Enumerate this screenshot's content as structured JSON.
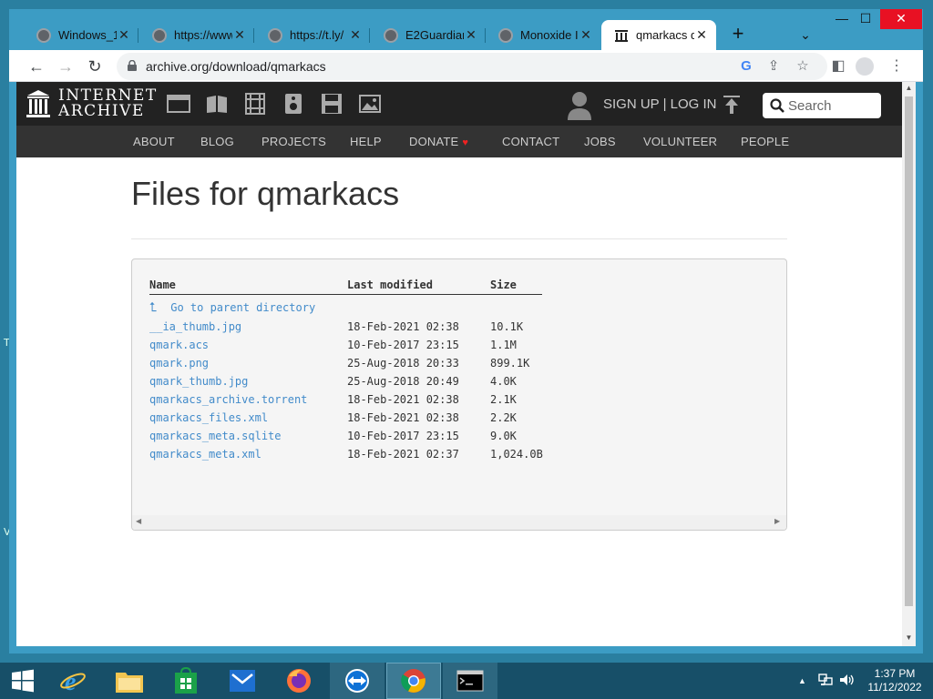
{
  "browser": {
    "tabs": [
      {
        "title": "Windows_1"
      },
      {
        "title": "https://www."
      },
      {
        "title": "https://t.ly/"
      },
      {
        "title": "E2Guardian"
      },
      {
        "title": "Monoxide I"
      },
      {
        "title": "qmarkacs d",
        "active": true
      }
    ],
    "new_tab": "+",
    "tab_menu": "⌄",
    "url": "archive.org/download/qmarkacs"
  },
  "site": {
    "logo_line1": "INTERNET",
    "logo_line2": "ARCHIVE",
    "signup": "SIGN UP | LOG IN",
    "search_placeholder": "Search",
    "nav": [
      "ABOUT",
      "BLOG",
      "PROJECTS",
      "HELP",
      "DONATE",
      "CONTACT",
      "JOBS",
      "VOLUNTEER",
      "PEOPLE"
    ],
    "donate_heart": "♥"
  },
  "page": {
    "title": "Files for qmarkacs",
    "columns": [
      "Name",
      "Last modified",
      "Size"
    ],
    "parent_link": "Go to parent directory",
    "files": [
      {
        "name": "__ia_thumb.jpg",
        "modified": "18-Feb-2021 02:38",
        "size": "10.1K"
      },
      {
        "name": "qmark.acs",
        "modified": "10-Feb-2017 23:15",
        "size": "1.1M"
      },
      {
        "name": "qmark.png",
        "modified": "25-Aug-2018 20:33",
        "size": "899.1K"
      },
      {
        "name": "qmark_thumb.jpg",
        "modified": "25-Aug-2018 20:49",
        "size": "4.0K"
      },
      {
        "name": "qmarkacs_archive.torrent",
        "modified": "18-Feb-2021 02:38",
        "size": "2.1K"
      },
      {
        "name": "qmarkacs_files.xml",
        "modified": "18-Feb-2021 02:38",
        "size": "2.2K"
      },
      {
        "name": "qmarkacs_meta.sqlite",
        "modified": "10-Feb-2017 23:15",
        "size": "9.0K"
      },
      {
        "name": "qmarkacs_meta.xml",
        "modified": "18-Feb-2021 02:37",
        "size": "1,024.0B"
      }
    ]
  },
  "taskbar": {
    "time": "1:37 PM",
    "date": "11/12/2022",
    "apps": [
      "start",
      "internet-explorer",
      "file-explorer",
      "store",
      "mail",
      "firefox",
      "teamviewer",
      "chrome",
      "command-prompt"
    ]
  },
  "desktop": {
    "edge_letter_1": "T",
    "edge_letter_2": "V"
  }
}
